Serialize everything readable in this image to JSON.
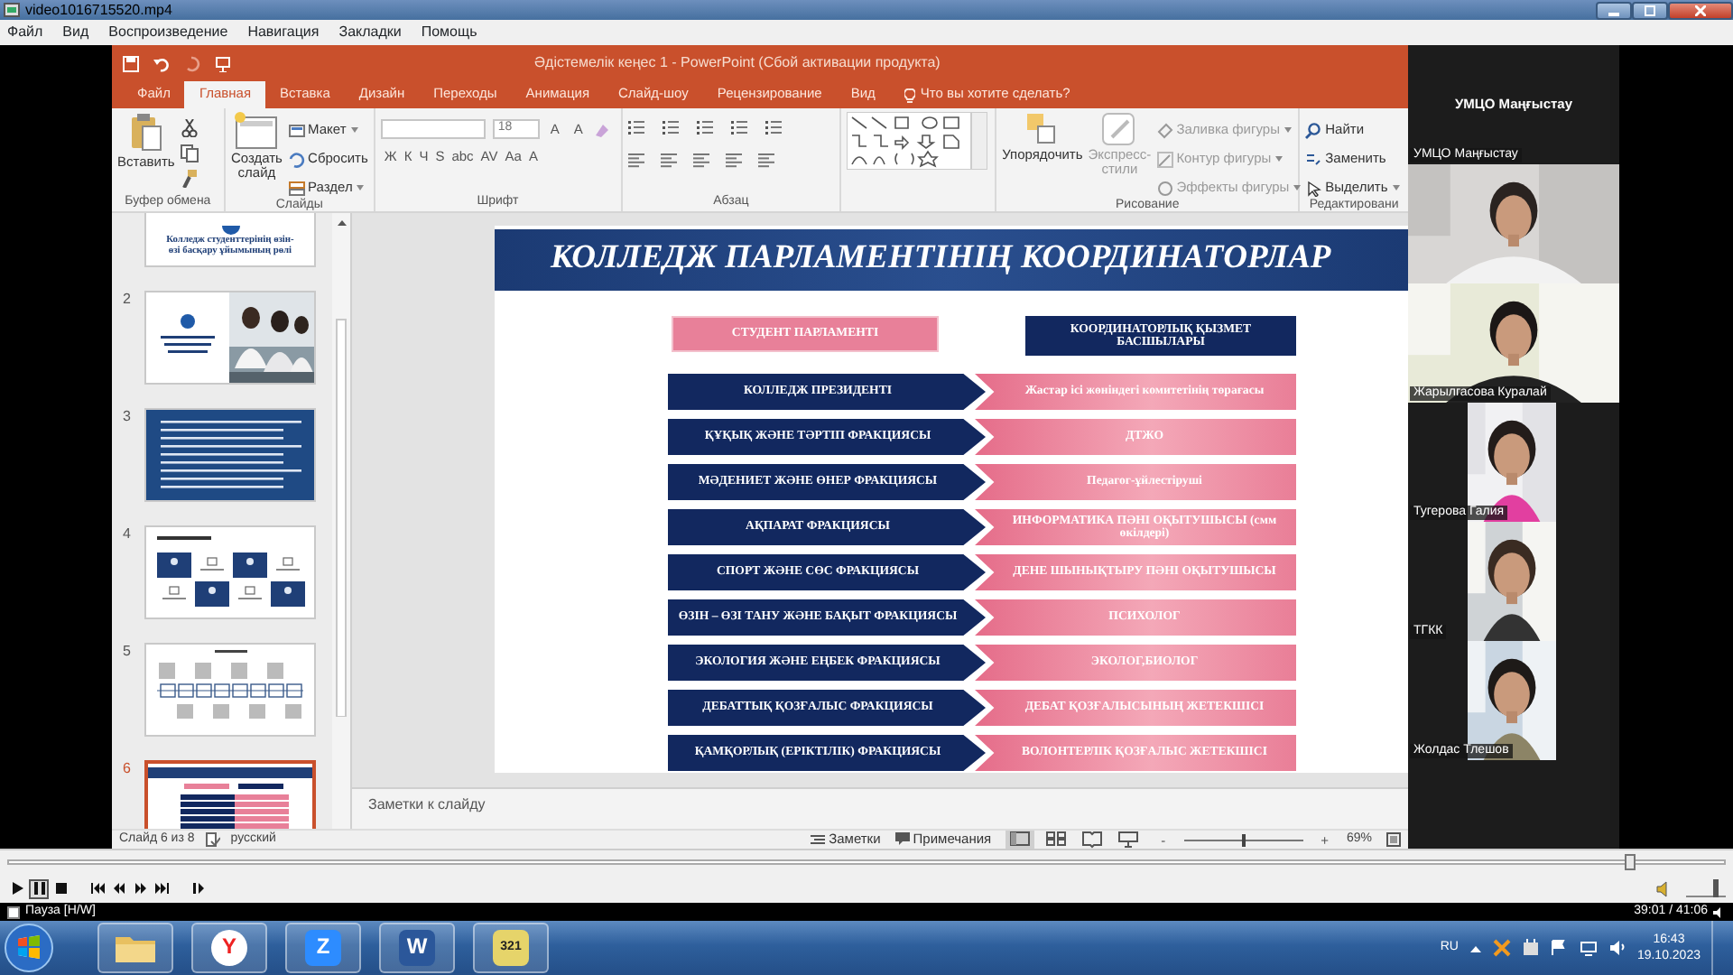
{
  "player": {
    "title": "video1016715520.mp4",
    "menu": [
      "Файл",
      "Вид",
      "Воспроизведение",
      "Навигация",
      "Закладки",
      "Помощь"
    ],
    "seek": {
      "level": 0.945
    },
    "controls": [
      {
        "kind": "play",
        "selected": false
      },
      {
        "kind": "pause",
        "selected": true
      },
      {
        "kind": "stop",
        "selected": false
      },
      {
        "kind": "prev",
        "selected": false
      },
      {
        "kind": "rewind",
        "selected": false
      },
      {
        "kind": "forward",
        "selected": false
      },
      {
        "kind": "next",
        "selected": false
      },
      {
        "kind": "frame",
        "selected": false
      }
    ],
    "volume": {
      "level": 0.75
    },
    "status": "Пауза [H/W]",
    "time": "39:01 / 41:06"
  },
  "powerpoint": {
    "title": "Әдістемелік кеңес 1 - PowerPoint (Сбой активации продукта)",
    "tabs": [
      {
        "label": "Файл",
        "selected": false
      },
      {
        "label": "Главная",
        "selected": true
      },
      {
        "label": "Вставка",
        "selected": false
      },
      {
        "label": "Дизайн",
        "selected": false
      },
      {
        "label": "Переходы",
        "selected": false
      },
      {
        "label": "Анимация",
        "selected": false
      },
      {
        "label": "Слайд-шоу",
        "selected": false
      },
      {
        "label": "Рецензирование",
        "selected": false
      },
      {
        "label": "Вид",
        "selected": false
      }
    ],
    "tell_me": "Что вы хотите сделать?",
    "ribbon": {
      "clipboard": {
        "label": "Буфер обмена",
        "paste": "Вставить"
      },
      "slides": {
        "label": "Слайды",
        "new_slide": "Создать слайд",
        "layout": "Макет",
        "reset": "Сбросить",
        "section": "Раздел"
      },
      "font": {
        "label": "Шрифт",
        "size": "18",
        "size_buttons": [
          "A",
          "A"
        ],
        "format_buttons": [
          "Ж",
          "К",
          "Ч",
          "S",
          "abc",
          "AV",
          "Aa",
          "A"
        ]
      },
      "paragraph": {
        "label": "Абзац"
      },
      "drawing": {
        "label": "Рисование",
        "arrange": "Упорядочить",
        "quick_styles": {
          "text": "Экспресс-стили",
          "disabled": true
        },
        "fill": {
          "text": "Заливка фигуры",
          "disabled": true
        },
        "outline": {
          "text": "Контур фигуры",
          "disabled": true
        },
        "effects": {
          "text": "Эффекты фигуры",
          "disabled": true
        }
      },
      "editing": {
        "label": "Редактировани",
        "find": "Найти",
        "replace": "Заменить",
        "select": "Выделить"
      }
    },
    "thumbnails": [
      {
        "kind": "title",
        "title": "Колледж студенттерінің өзін-өзі басқару ұйымының рөлі",
        "selected": false
      },
      {
        "number": "2",
        "selected": false
      },
      {
        "number": "3",
        "kind": "text",
        "selected": false
      },
      {
        "number": "4",
        "kind": "grid",
        "selected": false
      },
      {
        "number": "5",
        "kind": "diagram",
        "selected": false
      },
      {
        "number": "6",
        "kind": "table",
        "selected": true
      }
    ],
    "slide": {
      "title": "КОЛЛЕДЖ ПАРЛАМЕНТІНІҢ КООРДИНАТОРЛАР",
      "left_header": "СТУДЕНТ ПАРЛАМЕНТІ",
      "right_header": "КООРДИНАТОРЛЫҚ ҚЫЗМЕТ БАСШЫЛАРЫ",
      "rows": [
        {
          "left": "КОЛЛЕДЖ ПРЕЗИДЕНТІ",
          "right": "Жастар ісі жөніндегі комитетінің төрағасы"
        },
        {
          "left": "ҚҰҚЫҚ ЖӘНЕ ТӘРТІП ФРАКЦИЯСЫ",
          "right": "ДТЖО"
        },
        {
          "left": "МӘДЕНИЕТ ЖӘНЕ ӨНЕР ФРАКЦИЯСЫ",
          "right": "Педагог-ұйлестіруші"
        },
        {
          "left": "АҚПАРАТ ФРАКЦИЯСЫ",
          "right": "ИНФОРМАТИКА ПӘНІ ОҚЫТУШЫСЫ (смм өкілдері)"
        },
        {
          "left": "СПОРТ ЖӘНЕ СӨС ФРАКЦИЯСЫ",
          "right": "ДЕНЕ ШЫНЫҚТЫРУ ПӘНІ ОҚЫТУШЫСЫ"
        },
        {
          "left": "ӨЗІН – ӨЗІ ТАНУ ЖӘНЕ БАҚЫТ ФРАКЦИЯСЫ",
          "right": "ПСИХОЛОГ"
        },
        {
          "left": "ЭКОЛОГИЯ ЖӘНЕ ЕҢБЕК ФРАКЦИЯСЫ",
          "right": "ЭКОЛОГ,БИОЛОГ"
        },
        {
          "left": "ДЕБАТТЫҚ ҚОЗҒАЛЫС ФРАКЦИЯСЫ",
          "right": "ДЕБАТ ҚОЗҒАЛЫСЫНЫҢ ЖЕТЕКШІСІ"
        },
        {
          "left": "ҚАМҚОРЛЫҚ (ЕРІКТІЛІК) ФРАКЦИЯСЫ",
          "right": "ВОЛОНТЕРЛІК ҚОЗҒАЛЫС ЖЕТЕКШІСІ"
        }
      ]
    },
    "notes_placeholder": "Заметки к слайду",
    "status": {
      "slide": "Слайд 6 из 8",
      "language": "русский",
      "notes": "Заметки",
      "comments": "Примечания",
      "views": [
        {
          "kind": "normal",
          "selected": true
        },
        {
          "kind": "sorter",
          "selected": false
        },
        {
          "kind": "reading",
          "selected": false
        },
        {
          "kind": "show",
          "selected": false
        }
      ],
      "zoom_minus": "-",
      "zoom_plus": "+",
      "zoom": {
        "level": 0.5
      },
      "zoom_text": "69%"
    }
  },
  "meeting": {
    "participants": [
      {
        "kind": "camera_off",
        "title": "УМЦО Маңғыстау",
        "name": "УМЦО Маңғыстау"
      },
      {
        "kind": "video"
      },
      {
        "kind": "video",
        "name": "Жарылгасова Куралай"
      },
      {
        "kind": "narrow",
        "name": "Тугерова Галия"
      },
      {
        "kind": "narrow",
        "name": "ТГКК"
      },
      {
        "kind": "narrow",
        "name": "Жолдас Тлешов"
      }
    ]
  },
  "taskbar": {
    "apps": [
      {
        "kind": "start"
      },
      {
        "kind": "folder"
      },
      {
        "kind": "yandex",
        "glyph": "Y"
      },
      {
        "kind": "zapp",
        "glyph": "Z"
      },
      {
        "kind": "word",
        "glyph": "W"
      },
      {
        "kind": "player",
        "glyph": "321"
      }
    ],
    "language": "RU",
    "time": "16:43",
    "date": "19.10.2023"
  }
}
